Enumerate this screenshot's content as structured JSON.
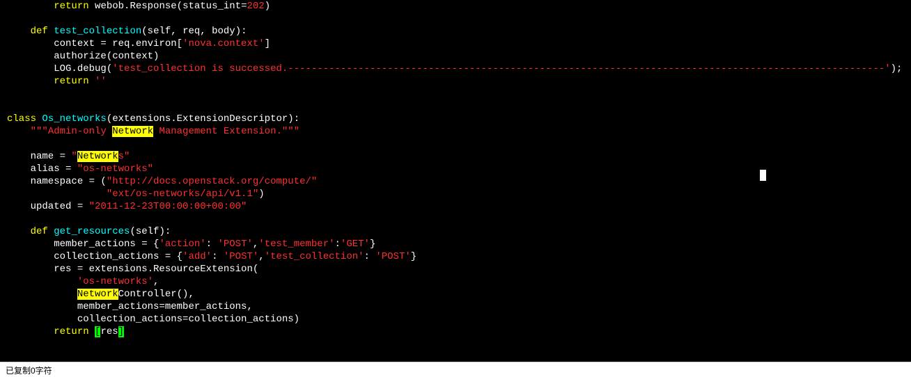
{
  "code": {
    "l1_a": "        ",
    "l1_kw": "return",
    "l1_b": " webob.Response(status_int=",
    "l1_c": "202",
    "l1_d": ")",
    "l3_a": "    ",
    "l3_kw": "def",
    "l3_b": " ",
    "l3_fn": "test_collection",
    "l3_c": "(self, req, body):",
    "l4": "        context = req.environ[",
    "l4_s": "'nova.context'",
    "l4_e": "]",
    "l5": "        authorize(context)",
    "l6": "        LOG.debug(",
    "l6_s": "'test_collection is successed.------------------------------------------------------------------------------------------------------'",
    "l6_e": ");",
    "l7_a": "        ",
    "l7_kw": "return",
    "l7_b": " ",
    "l7_s": "''",
    "l9_kw": "class",
    "l9_b": " ",
    "l9_fn": "Os_networks",
    "l9_c": "(extensions.ExtensionDescriptor):",
    "l10_a": "    ",
    "l10_s1": "\"\"\"Admin-only ",
    "l10_hl": "Network",
    "l10_s2": " Management Extension.\"\"\"",
    "l12_a": "    name = ",
    "l12_s1": "\"",
    "l12_hl": "Network",
    "l12_s2": "s\"",
    "l13_a": "    alias = ",
    "l13_s": "\"os-networks\"",
    "l14_a": "    namespace = (",
    "l14_s": "\"http://docs.openstack.org/compute/\"",
    "l15_a": "                 ",
    "l15_s": "\"ext/os-networks/api/v1.1\"",
    "l15_b": ")",
    "l16_a": "    updated = ",
    "l16_s": "\"2011-12-23T00:00:00+00:00\"",
    "l18_a": "    ",
    "l18_kw": "def",
    "l18_b": " ",
    "l18_fn": "get_resources",
    "l18_c": "(self):",
    "l19_a": "        member_actions = {",
    "l19_s1": "'action'",
    "l19_b": ": ",
    "l19_s2": "'POST'",
    "l19_c": ",",
    "l19_s3": "'test_member'",
    "l19_d": ":",
    "l19_s4": "'GET'",
    "l19_e": "}",
    "l20_a": "        collection_actions = {",
    "l20_s1": "'add'",
    "l20_b": ": ",
    "l20_s2": "'POST'",
    "l20_c": ",",
    "l20_s3": "'test_collection'",
    "l20_d": ": ",
    "l20_s4": "'POST'",
    "l20_e": "}",
    "l21": "        res = extensions.ResourceExtension(",
    "l22_a": "            ",
    "l22_s": "'os-networks'",
    "l22_b": ",",
    "l23_a": "            ",
    "l23_hl": "Network",
    "l23_b": "Controller(),",
    "l24": "            member_actions=member_actions,",
    "l25": "            collection_actions=collection_actions)",
    "l26_a": "        ",
    "l26_kw": "return",
    "l26_b": " ",
    "l26_br1": "[",
    "l26_c": "res",
    "l26_br2": "]"
  },
  "status": "已复制0字符"
}
